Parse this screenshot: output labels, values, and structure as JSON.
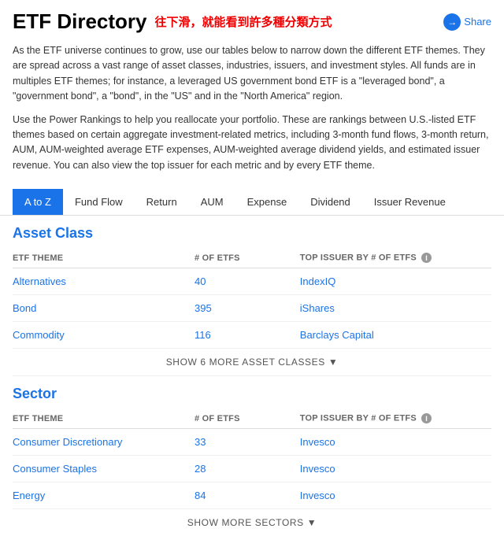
{
  "header": {
    "title": "ETF Directory",
    "annotation": "往下滑，就能看到許多種分類方式",
    "share_label": "Share"
  },
  "description": {
    "para1": "As the ETF universe continues to grow, use our tables below to narrow down the different ETF themes. They are spread across a vast range of asset classes, industries, issuers, and investment styles. All funds are in multiples ETF themes; for instance, a leveraged US government bond ETF is a \"leveraged bond\", a \"government bond\", a \"bond\", in the \"US\" and in the \"North America\" region.",
    "para2": "Use the Power Rankings to help you reallocate your portfolio. These are rankings between U.S.-listed ETF themes based on certain aggregate investment-related metrics, including 3-month fund flows, 3-month return, AUM, AUM-weighted average ETF expenses, AUM-weighted average dividend yields, and estimated issuer revenue. You can also view the top issuer for each metric and by every ETF theme."
  },
  "tabs": [
    {
      "label": "A to Z",
      "active": true
    },
    {
      "label": "Fund Flow",
      "active": false
    },
    {
      "label": "Return",
      "active": false
    },
    {
      "label": "AUM",
      "active": false
    },
    {
      "label": "Expense",
      "active": false
    },
    {
      "label": "Dividend",
      "active": false
    },
    {
      "label": "Issuer Revenue",
      "active": false
    }
  ],
  "asset_class": {
    "section_title": "Asset Class",
    "col_theme": "ETF THEME",
    "col_count": "# OF ETFs",
    "col_issuer": "TOP ISSUER BY # OF ETFs",
    "rows": [
      {
        "theme": "Alternatives",
        "count": "40",
        "issuer": "IndexIQ"
      },
      {
        "theme": "Bond",
        "count": "395",
        "issuer": "iShares"
      },
      {
        "theme": "Commodity",
        "count": "116",
        "issuer": "Barclays Capital"
      }
    ],
    "show_more": "SHOW 6 MORE ASSET CLASSES"
  },
  "sector": {
    "section_title": "Sector",
    "col_theme": "ETF THEME",
    "col_count": "# OF ETFs",
    "col_issuer": "TOP ISSUER BY # OF ETFs",
    "rows": [
      {
        "theme": "Consumer Discretionary",
        "count": "33",
        "issuer": "Invesco"
      },
      {
        "theme": "Consumer Staples",
        "count": "28",
        "issuer": "Invesco"
      },
      {
        "theme": "Energy",
        "count": "84",
        "issuer": "Invesco"
      }
    ],
    "show_more": "SHOW MORE SECTORS"
  }
}
